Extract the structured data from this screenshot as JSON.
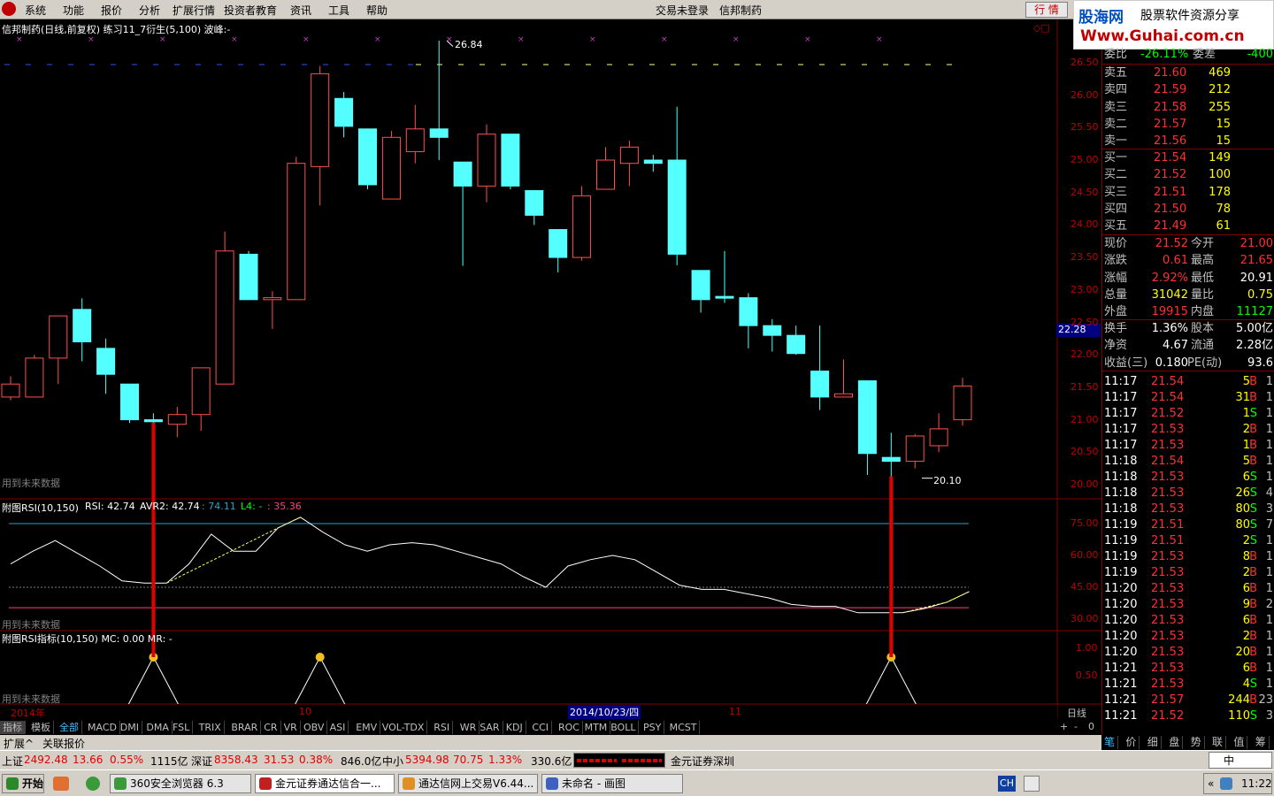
{
  "menu": {
    "items": [
      "系统",
      "功能",
      "报价",
      "分析",
      "扩展行情",
      "投资者教育",
      "资讯",
      "工具",
      "帮助"
    ],
    "login_status": "交易未登录",
    "stock_name": "信邦制药",
    "hq_button": "行 情"
  },
  "logo": {
    "line1": "股海网",
    "line2": "股票软件资源分享",
    "line3": "Www.Guhai.com.cn"
  },
  "main_chart": {
    "header": "信邦制药(日线,前复权) 练习11_7衍生(5,100)  波峰:-",
    "future_text": "用到未来数据",
    "high_label": "26.84",
    "low_label": "20.10",
    "current_price_tag": "22.28",
    "price_axis": [
      "26.50",
      "26.00",
      "25.50",
      "25.00",
      "24.50",
      "24.00",
      "23.50",
      "23.00",
      "22.50",
      "22.00",
      "21.50",
      "21.00",
      "20.50",
      "20.00"
    ]
  },
  "rsi_panel": {
    "header_name": "附图RSI(10,150)",
    "rsi_text": "RSI: 42.74",
    "avr_text": "AVR2: 42.74",
    "v2": ": 74.11",
    "l4": "L4: -",
    "v3": ": 35.36",
    "axis": [
      "75.00",
      "60.00",
      "45.00",
      "30.00"
    ],
    "future_text": "用到未来数据"
  },
  "rsi_ind_panel": {
    "header": "附图RSI指标(10,150)  MC: 0.00   MR: -",
    "axis": [
      "1.00",
      "0.50"
    ],
    "future_text": "用到未来数据"
  },
  "date_axis": {
    "year": "2014年",
    "m10": "10",
    "cursor_date": "2014/10/23/四",
    "m11": "11",
    "period": "日线"
  },
  "indicator_tabs": [
    "指标",
    "模板",
    "全部",
    "MACD",
    "DMI",
    "DMA",
    "FSL",
    "TRIX",
    "BRAR",
    "CR",
    "VR",
    "OBV",
    "ASI",
    "EMV",
    "VOL-TDX",
    "RSI",
    "WR",
    "SAR",
    "KDJ",
    "CCI",
    "ROC",
    "MTM",
    "BOLL",
    "PSY",
    "MCST"
  ],
  "tab_controls": [
    "+",
    "-",
    "0"
  ],
  "bottom_bar": [
    "扩展^",
    "关联报价"
  ],
  "quote": {
    "weibi_label": "委比",
    "weibi_value": "-26.11%",
    "weicha_label": "委差",
    "weicha_value": "-400",
    "sell": [
      {
        "label": "卖五",
        "price": "21.60",
        "vol": "469"
      },
      {
        "label": "卖四",
        "price": "21.59",
        "vol": "212"
      },
      {
        "label": "卖三",
        "price": "21.58",
        "vol": "255"
      },
      {
        "label": "卖二",
        "price": "21.57",
        "vol": "15"
      },
      {
        "label": "卖一",
        "price": "21.56",
        "vol": "15"
      }
    ],
    "buy": [
      {
        "label": "买一",
        "price": "21.54",
        "vol": "149"
      },
      {
        "label": "买二",
        "price": "21.52",
        "vol": "100"
      },
      {
        "label": "买三",
        "price": "21.51",
        "vol": "178"
      },
      {
        "label": "买四",
        "price": "21.50",
        "vol": "78"
      },
      {
        "label": "买五",
        "price": "21.49",
        "vol": "61"
      }
    ],
    "stats": [
      {
        "l1": "现价",
        "v1": "21.52",
        "l2": "今开",
        "v2": "21.00",
        "c1": "#ff3030",
        "c2": "#ff3030"
      },
      {
        "l1": "涨跌",
        "v1": "0.61",
        "l2": "最高",
        "v2": "21.65",
        "c1": "#ff3030",
        "c2": "#ff3030"
      },
      {
        "l1": "涨幅",
        "v1": "2.92%",
        "l2": "最低",
        "v2": "20.91",
        "c1": "#ff3030",
        "c2": "#ffffff"
      },
      {
        "l1": "总量",
        "v1": "31042",
        "l2": "量比",
        "v2": "0.75",
        "c1": "#ffff00",
        "c2": "#ffff00"
      },
      {
        "l1": "外盘",
        "v1": "19915",
        "l2": "内盘",
        "v2": "11127",
        "c1": "#ff3030",
        "c2": "#00ff00"
      }
    ],
    "fund": [
      {
        "l1": "换手",
        "v1": "1.36%",
        "l2": "股本",
        "v2": "5.00亿"
      },
      {
        "l1": "净资",
        "v1": "4.67",
        "l2": "流通",
        "v2": "2.28亿"
      },
      {
        "l1": "收益(三)",
        "v1": "0.180",
        "l2": "PE(动)",
        "v2": "93.6"
      }
    ],
    "ticks": [
      [
        "11:17",
        "21.54",
        "5",
        "B",
        "1"
      ],
      [
        "11:17",
        "21.54",
        "31",
        "B",
        "1"
      ],
      [
        "11:17",
        "21.52",
        "1",
        "S",
        "1"
      ],
      [
        "11:17",
        "21.53",
        "2",
        "B",
        "1"
      ],
      [
        "11:17",
        "21.53",
        "1",
        "B",
        "1"
      ],
      [
        "11:18",
        "21.54",
        "5",
        "B",
        "1"
      ],
      [
        "11:18",
        "21.53",
        "6",
        "S",
        "1"
      ],
      [
        "11:18",
        "21.53",
        "26",
        "S",
        "4"
      ],
      [
        "11:18",
        "21.53",
        "80",
        "S",
        "3"
      ],
      [
        "11:19",
        "21.51",
        "80",
        "S",
        "7"
      ],
      [
        "11:19",
        "21.51",
        "2",
        "S",
        "1"
      ],
      [
        "11:19",
        "21.53",
        "8",
        "B",
        "1"
      ],
      [
        "11:19",
        "21.53",
        "2",
        "B",
        "1"
      ],
      [
        "11:20",
        "21.53",
        "6",
        "B",
        "1"
      ],
      [
        "11:20",
        "21.53",
        "9",
        "B",
        "2"
      ],
      [
        "11:20",
        "21.53",
        "6",
        "B",
        "1"
      ],
      [
        "11:20",
        "21.53",
        "2",
        "B",
        "1"
      ],
      [
        "11:20",
        "21.53",
        "20",
        "B",
        "1"
      ],
      [
        "11:21",
        "21.53",
        "6",
        "B",
        "1"
      ],
      [
        "11:21",
        "21.53",
        "4",
        "S",
        "1"
      ],
      [
        "11:21",
        "21.57",
        "244",
        "B",
        "23"
      ],
      [
        "11:21",
        "21.52",
        "110",
        "S",
        "3"
      ]
    ],
    "bottom_tabs": [
      "笔",
      "价",
      "细",
      "盘",
      "势",
      "联",
      "值",
      "筹"
    ]
  },
  "status_bar": {
    "sh_label": "上证",
    "sh_value": "2492.48",
    "sh_change": "13.66",
    "sh_pct": "0.55%",
    "sh_amt": "1115亿",
    "sz_label": "深证",
    "sz_value": "8358.43",
    "sz_change": "31.53",
    "sz_pct": "0.38%",
    "sz_amt": "846.0亿",
    "zx_label": "中小",
    "zx_value": "5394.98",
    "zx_change": "70.75",
    "zx_pct": "1.33%",
    "zx_amt": "330.6亿",
    "broker": "金元证券深圳",
    "ime": "中"
  },
  "taskbar": {
    "start": "开始",
    "tasks": [
      "360安全浏览器 6.3",
      "金元证券通达信合一...",
      "通达信网上交易V6.44...",
      "未命名 - 画图"
    ],
    "time": "11:22",
    "lang": "CH"
  },
  "candles": [
    {
      "o": 21.35,
      "c": 21.55,
      "h": 21.67,
      "l": 21.3
    },
    {
      "o": 21.35,
      "c": 21.95,
      "h": 22.0,
      "l": 21.35
    },
    {
      "o": 21.95,
      "c": 22.6,
      "h": 22.6,
      "l": 21.55
    },
    {
      "o": 22.7,
      "c": 22.2,
      "h": 22.87,
      "l": 21.9
    },
    {
      "o": 22.1,
      "c": 21.7,
      "h": 22.25,
      "l": 21.4
    },
    {
      "o": 21.55,
      "c": 21.0,
      "h": 21.55,
      "l": 20.95
    },
    {
      "o": 21.0,
      "c": 20.97,
      "h": 21.1,
      "l": 20.93
    },
    {
      "o": 20.93,
      "c": 21.08,
      "h": 21.2,
      "l": 20.73
    },
    {
      "o": 21.08,
      "c": 21.8,
      "h": 21.8,
      "l": 20.83
    },
    {
      "o": 21.55,
      "c": 23.6,
      "h": 23.9,
      "l": 21.55
    },
    {
      "o": 23.55,
      "c": 22.85,
      "h": 23.6,
      "l": 22.85
    },
    {
      "o": 22.85,
      "c": 22.88,
      "h": 22.98,
      "l": 22.4
    },
    {
      "o": 22.85,
      "c": 24.95,
      "h": 25.05,
      "l": 22.85
    },
    {
      "o": 24.9,
      "c": 26.33,
      "h": 26.45,
      "l": 24.3
    },
    {
      "o": 25.95,
      "c": 25.52,
      "h": 26.05,
      "l": 25.35
    },
    {
      "o": 25.48,
      "c": 24.62,
      "h": 25.48,
      "l": 24.55
    },
    {
      "o": 24.4,
      "c": 25.35,
      "h": 25.45,
      "l": 24.4
    },
    {
      "o": 25.13,
      "c": 25.48,
      "h": 25.85,
      "l": 24.95
    },
    {
      "o": 25.48,
      "c": 25.35,
      "h": 26.84,
      "l": 25.0
    },
    {
      "o": 24.97,
      "c": 24.6,
      "h": 24.97,
      "l": 23.37
    },
    {
      "o": 24.6,
      "c": 25.4,
      "h": 25.55,
      "l": 24.35
    },
    {
      "o": 25.4,
      "c": 24.6,
      "h": 25.4,
      "l": 24.55
    },
    {
      "o": 24.53,
      "c": 24.15,
      "h": 24.53,
      "l": 24.0
    },
    {
      "o": 23.93,
      "c": 23.5,
      "h": 23.93,
      "l": 23.27
    },
    {
      "o": 23.5,
      "c": 24.45,
      "h": 24.6,
      "l": 23.45
    },
    {
      "o": 24.55,
      "c": 25.0,
      "h": 25.2,
      "l": 24.55
    },
    {
      "o": 24.95,
      "c": 25.2,
      "h": 25.3,
      "l": 24.6
    },
    {
      "o": 25.0,
      "c": 24.95,
      "h": 25.08,
      "l": 24.82
    },
    {
      "o": 25.0,
      "c": 23.55,
      "h": 25.82,
      "l": 23.38
    },
    {
      "o": 23.3,
      "c": 22.85,
      "h": 23.3,
      "l": 22.65
    },
    {
      "o": 22.9,
      "c": 22.88,
      "h": 23.6,
      "l": 22.8
    },
    {
      "o": 22.88,
      "c": 22.45,
      "h": 22.95,
      "l": 22.1
    },
    {
      "o": 22.45,
      "c": 22.3,
      "h": 22.55,
      "l": 22.05
    },
    {
      "o": 22.3,
      "c": 22.02,
      "h": 22.45,
      "l": 22.0
    },
    {
      "o": 21.75,
      "c": 21.35,
      "h": 22.45,
      "l": 21.15
    },
    {
      "o": 21.35,
      "c": 21.4,
      "h": 21.93,
      "l": 21.35
    },
    {
      "o": 21.6,
      "c": 20.48,
      "h": 21.6,
      "l": 20.15
    },
    {
      "o": 20.42,
      "c": 20.36,
      "h": 20.8,
      "l": 20.1
    },
    {
      "o": 20.36,
      "c": 20.75,
      "h": 20.78,
      "l": 20.25
    },
    {
      "o": 20.6,
      "c": 20.86,
      "h": 21.1,
      "l": 20.5
    },
    {
      "o": 21.0,
      "c": 21.52,
      "h": 21.65,
      "l": 20.91
    }
  ],
  "rsi_series": [
    56,
    62,
    67,
    61,
    55,
    48,
    47,
    47,
    56,
    70,
    62,
    62,
    73,
    78,
    71,
    65,
    62,
    65,
    66,
    65,
    62,
    59,
    56,
    50,
    45,
    55,
    58,
    60,
    58,
    52,
    46,
    44,
    44,
    42,
    40,
    37,
    36,
    36,
    33,
    33,
    33,
    35,
    38,
    43
  ],
  "signals": [
    6,
    13,
    37
  ]
}
